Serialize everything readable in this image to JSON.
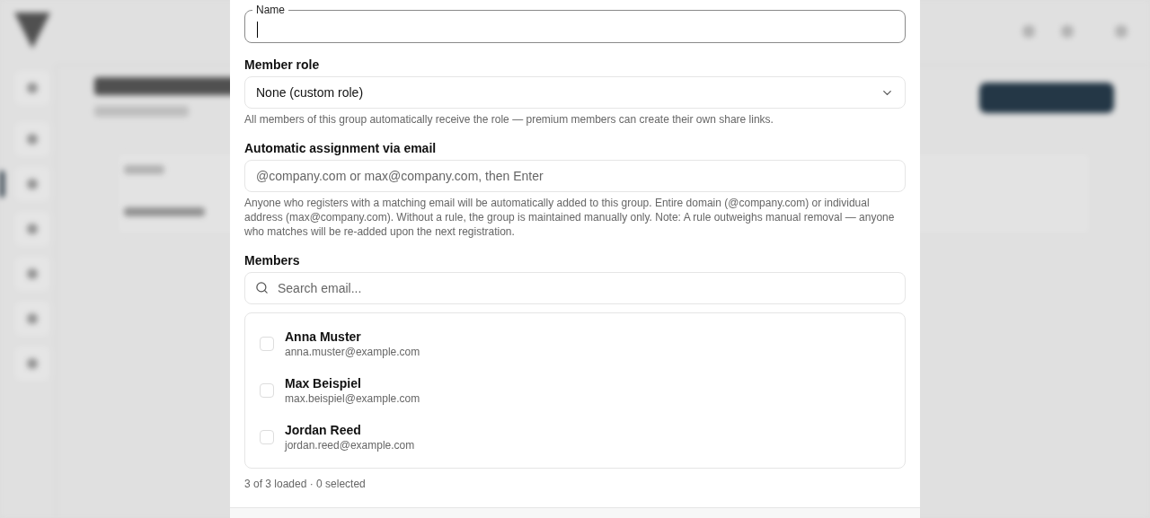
{
  "name_field": {
    "label": "Name",
    "focused": true
  },
  "member_role": {
    "label": "Member role",
    "value": "None (custom role)",
    "help": "All members of this group automatically receive the role — premium members can create their own share links."
  },
  "auto_assign": {
    "label": "Automatic assignment via email",
    "placeholder": "@company.com or max@company.com, then Enter",
    "help": "Anyone who registers with a matching email will be automatically added to this group. Entire domain (@company.com) or individual address (max@company.com). Without a rule, the group is maintained manually only. Note: A rule outweighs manual removal — anyone who matches will be re-added upon the next registration."
  },
  "members": {
    "label": "Members",
    "search_placeholder": "Search email...",
    "items": [
      {
        "name": "Anna Muster",
        "email": "anna.muster@example.com",
        "checked": false
      },
      {
        "name": "Max Beispiel",
        "email": "max.beispiel@example.com",
        "checked": false
      },
      {
        "name": "Jordan Reed",
        "email": "jordan.reed@example.com",
        "checked": false
      }
    ],
    "status": "3 of 3 loaded · 0 selected"
  }
}
